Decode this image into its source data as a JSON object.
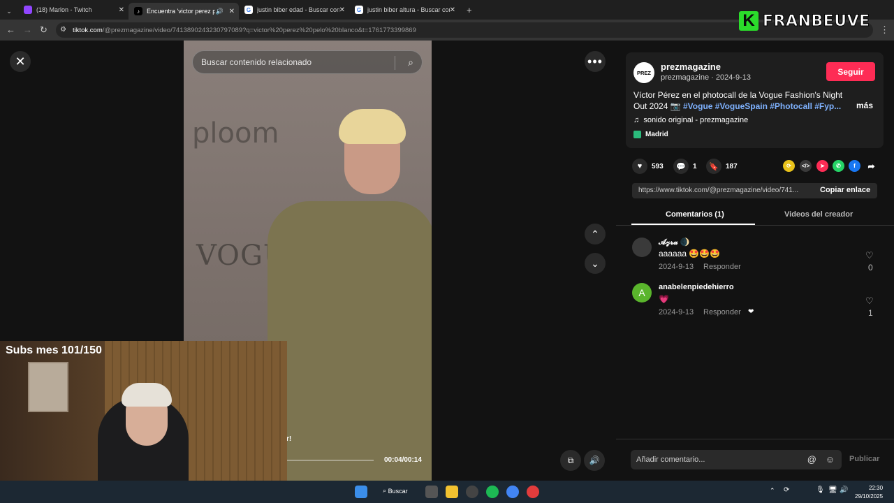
{
  "browser": {
    "tabs": [
      {
        "label": "(18) Marlon - Twitch",
        "favicon": "twitch-icon",
        "color": "#9146ff"
      },
      {
        "label": "Encuentra 'victor perez pelo'",
        "favicon": "tiktok-icon",
        "color": "#000000"
      },
      {
        "label": "justin biber edad - Buscar con",
        "favicon": "google-icon",
        "color": "#ffffff"
      },
      {
        "label": "justin biber altura - Buscar con",
        "favicon": "google-icon",
        "color": "#ffffff"
      }
    ],
    "url_host": "tiktok.com",
    "url_path": "/@prezmagazine/video/7413890243230797089?q=victor%20perez%20pelo%20blanco&t=1761773399869"
  },
  "watermark": {
    "letter": "K",
    "name": "FRANBEUVE"
  },
  "video": {
    "search_placeholder": "Buscar contenido relacionado",
    "logo_text_1": "ploom",
    "logo_text_2": "VOGUE",
    "time": "00:04/00:14",
    "overlay_tag": "r!"
  },
  "webcam": {
    "subs_text": "Subs mes 101/150"
  },
  "post": {
    "avatar_text": "PREZ",
    "author": "prezmagazine",
    "author_sub": "prezmagazine · 2024-9-13",
    "follow_label": "Seguir",
    "description": "Víctor Pérez en el photocall de la Vogue Fashion's Night Out 2024 📷",
    "hashtags": "#Vogue #VogueSpain #Photocall #Fyp...",
    "more_label": "más",
    "sound": "sonido original - prezmagazine",
    "location": "Madrid",
    "likes": "593",
    "comments": "1",
    "saves": "187",
    "link": "https://www.tiktok.com/@prezmagazine/video/741...",
    "copy_label": "Copiar enlace"
  },
  "tabs": {
    "comments": "Comentarios (1)",
    "creator_videos": "Videos del creador"
  },
  "comments": [
    {
      "user": "𝓐𝔃𝓻𝓪 🌒",
      "text": "aaaaaa 🤩🤩🤩",
      "date": "2024-9-13",
      "reply": "Responder",
      "likes": "0",
      "avatar_color": "#3a3a3a"
    },
    {
      "user": "anabelenpiedehierro",
      "text": "💗",
      "date": "2024-9-13",
      "reply": "Responder",
      "likes": "1",
      "avatar_letter": "A",
      "avatar_color": "#5ab52c"
    }
  ],
  "compose": {
    "placeholder": "Añadir comentario...",
    "publish": "Publicar"
  },
  "taskbar": {
    "search_label": "Buscar",
    "time": "22:30",
    "date": "29/10/2025"
  }
}
